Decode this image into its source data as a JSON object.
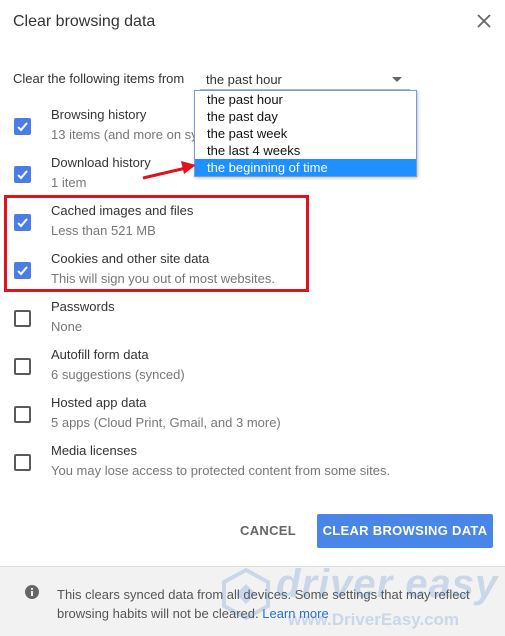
{
  "dialog": {
    "title": "Clear browsing data",
    "close_icon": "close-icon"
  },
  "time_range": {
    "label": "Clear the following items from",
    "selected": "the past hour",
    "options": [
      "the past hour",
      "the past day",
      "the past week",
      "the last 4 weeks",
      "the beginning of time"
    ],
    "highlighted_option": "the beginning of time"
  },
  "items": [
    {
      "label": "Browsing history",
      "sub": "13 items (and more on sy",
      "checked": true
    },
    {
      "label": "Download history",
      "sub": "1 item",
      "checked": true
    },
    {
      "label": "Cached images and files",
      "sub": "Less than 521 MB",
      "checked": true
    },
    {
      "label": "Cookies and other site data",
      "sub": "This will sign you out of most websites.",
      "checked": true
    },
    {
      "label": "Passwords",
      "sub": "None",
      "checked": false
    },
    {
      "label": "Autofill form data",
      "sub": "6 suggestions (synced)",
      "checked": false
    },
    {
      "label": "Hosted app data",
      "sub": "5 apps (Cloud Print, Gmail, and 3 more)",
      "checked": false
    },
    {
      "label": "Media licenses",
      "sub": "You may lose access to protected content from some sites.",
      "checked": false
    }
  ],
  "buttons": {
    "cancel": "CANCEL",
    "clear": "CLEAR BROWSING DATA"
  },
  "footer": {
    "text": "This clears synced data from all devices. Some settings that may reflect browsing habits will not be cleared.",
    "link": "Learn more"
  },
  "watermark": {
    "brand": "driver easy",
    "url": "www.DriverEasy.com"
  },
  "colors": {
    "accent": "#4a86e8",
    "checkbox": "#4a7ee3",
    "annotation_red": "#e1121b",
    "dropdown_selected": "#1e90ff"
  }
}
